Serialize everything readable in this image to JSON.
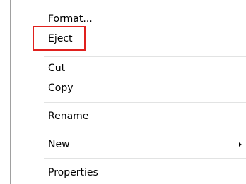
{
  "context_menu": {
    "items": [
      {
        "label": "Format..."
      },
      {
        "label": "Eject"
      },
      {
        "label": "Cut"
      },
      {
        "label": "Copy"
      },
      {
        "label": "Rename"
      },
      {
        "label": "New"
      },
      {
        "label": "Properties"
      }
    ],
    "highlighted_item": "Eject",
    "highlight_color": "#e0201d"
  }
}
